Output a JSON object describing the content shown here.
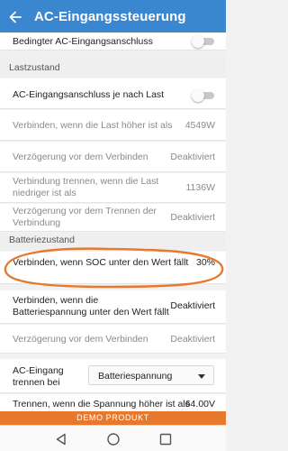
{
  "header": {
    "title": "AC-Eingangssteuerung",
    "bg_color": "#3a87cf"
  },
  "rows": {
    "conditional_connect": {
      "label": "Bedingter AC-Eingangsanschluss",
      "toggle_on": false
    },
    "section_load": "Lastzustand",
    "load_dependent": {
      "label": "AC-Eingangsanschluss je nach Last",
      "toggle_on": false
    },
    "connect_load_above": {
      "label": "Verbinden, wenn die Last höher ist als",
      "value": "4549W"
    },
    "delay_before_connect_1": {
      "label": "Verzögerung vor dem Verbinden",
      "value": "Deaktiviert"
    },
    "disconnect_load_below": {
      "label": "Verbindung trennen, wenn die Last niedriger ist als",
      "value": "1136W"
    },
    "delay_before_disconnect": {
      "label": "Verzögerung vor dem Trennen der Verbindung",
      "value": "Deaktiviert"
    },
    "section_battery": "Batteriezustand",
    "connect_soc_below": {
      "label": "Verbinden, wenn SOC unter den Wert fällt",
      "value": "30%"
    },
    "connect_voltage_below": {
      "label": "Verbinden, wenn die Batteriespannung unter den Wert fällt",
      "value": "Deaktiviert"
    },
    "delay_before_connect_2": {
      "label": "Verzögerung vor dem Verbinden",
      "value": "Deaktiviert"
    },
    "ac_disconnect_by": {
      "label": "AC-Eingang trennen bei",
      "selected": "Batteriespannung"
    },
    "disconnect_voltage_above": {
      "label": "Trennen, wenn die Spannung höher ist als",
      "value": "64.00V"
    }
  },
  "banner": {
    "text": "DEMO PRODUKT",
    "color": "#e8782c"
  },
  "navbar": {
    "icons": [
      "back-triangle-icon",
      "home-circle-icon",
      "recents-square-icon"
    ]
  },
  "annotation": {
    "color": "#e8782c"
  }
}
